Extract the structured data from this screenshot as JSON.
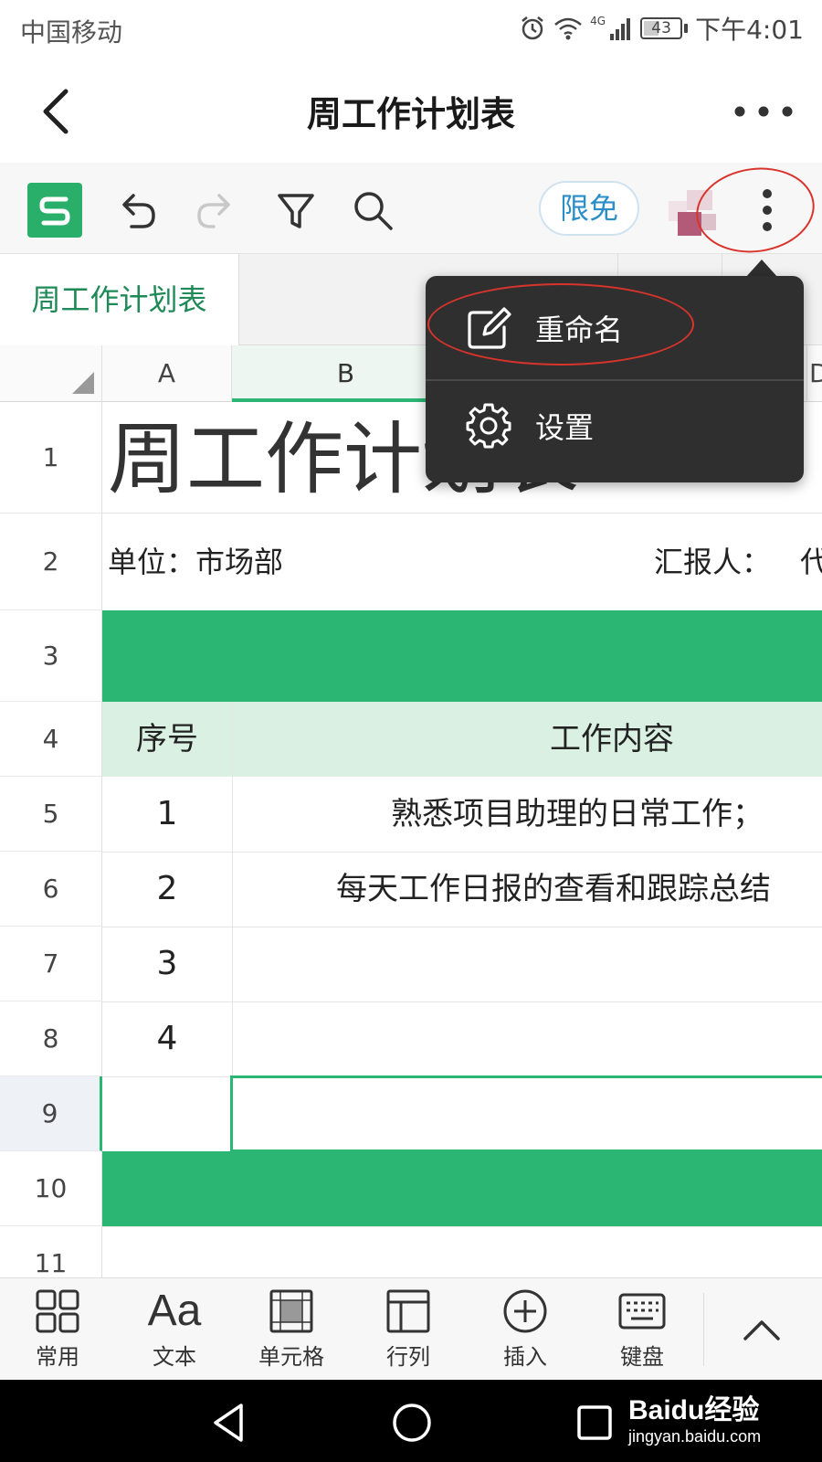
{
  "status_bar": {
    "carrier": "中国移动",
    "network": "4G",
    "battery": "43",
    "time": "下午4:01"
  },
  "header": {
    "title": "周工作计划表"
  },
  "toolbar": {
    "badge": "限免"
  },
  "sheet_tabs": [
    {
      "label": "周工作计划表",
      "active": true
    }
  ],
  "grid": {
    "columns": [
      "A",
      "B",
      "D"
    ],
    "rows": [
      "1",
      "2",
      "3",
      "4",
      "5",
      "6",
      "7",
      "8",
      "9",
      "10",
      "11"
    ],
    "title_cell": "周工作计划表",
    "unit": "单位：市场部",
    "reporter": "汇报人：",
    "reporter_partial": "代",
    "header_no": "序号",
    "header_content": "工作内容",
    "items": [
      {
        "no": "1",
        "content": "熟悉项目助理的日常工作；"
      },
      {
        "no": "2",
        "content": "每天工作日报的查看和跟踪总结"
      },
      {
        "no": "3",
        "content": ""
      },
      {
        "no": "4",
        "content": ""
      }
    ]
  },
  "menu": {
    "items": [
      {
        "label": "重命名",
        "icon": "edit-icon"
      },
      {
        "label": "设置",
        "icon": "gear-icon"
      }
    ]
  },
  "bottom_toolbar": [
    {
      "label": "常用",
      "icon": "grid-icon"
    },
    {
      "label": "文本",
      "icon": "text-format-icon",
      "glyph": "Aa"
    },
    {
      "label": "单元格",
      "icon": "cell-icon"
    },
    {
      "label": "行列",
      "icon": "row-column-icon"
    },
    {
      "label": "插入",
      "icon": "insert-icon"
    },
    {
      "label": "键盘",
      "icon": "keyboard-icon"
    }
  ],
  "watermark": {
    "main": "Baidu经验",
    "sub": "jingyan.baidu.com"
  },
  "colors": {
    "accent_green": "#2bb673",
    "brand_green": "#2aaf6a",
    "header_light_green": "#d9f0e3",
    "menu_bg": "#2f2f2f",
    "annotation_red": "#d9342b"
  }
}
